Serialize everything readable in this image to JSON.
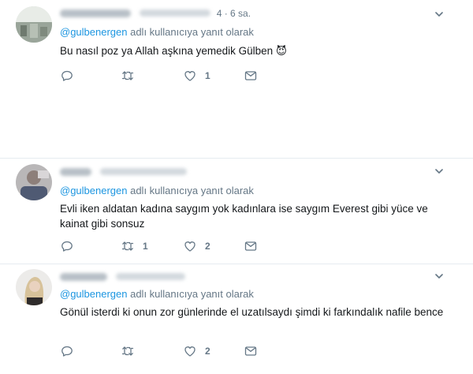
{
  "tweets": [
    {
      "author_name": "",
      "author_handle": "",
      "time": "4 · 6 sa.",
      "reply_prefix": "@gulbenergen",
      "reply_suffix": " adlı kullanıcıya yanıt olarak",
      "text": "Bu nasıl poz ya Allah aşkına yemedik Gülben 😈",
      "replies": "",
      "retweets": "",
      "likes": "1",
      "icons": [
        "reply-icon",
        "retweet-icon",
        "like-icon",
        "message-icon"
      ]
    },
    {
      "author_name": "",
      "author_handle": "",
      "time": "",
      "reply_prefix": "@gulbenergen",
      "reply_suffix": " adlı kullanıcıya yanıt olarak",
      "text": "Evli iken aldatan kadına saygım yok kadınlara ise saygım Everest gibi yüce ve kainat gibi sonsuz",
      "replies": "",
      "retweets": "1",
      "likes": "2",
      "icons": [
        "reply-icon",
        "retweet-icon",
        "like-icon",
        "message-icon"
      ]
    },
    {
      "author_name": "",
      "author_handle": "",
      "time": "",
      "reply_prefix": "@gulbenergen",
      "reply_suffix": " adlı kullanıcıya yanıt olarak",
      "text": "Gönül isterdi ki onun zor günlerinde el uzatılsaydı şimdi ki farkındalık nafile bence",
      "replies": "",
      "retweets": "",
      "likes": "2",
      "icons": [
        "reply-icon",
        "retweet-icon",
        "like-icon",
        "message-icon"
      ]
    }
  ],
  "colors": {
    "mention": "#1b95e0",
    "secondary_text": "#657786",
    "divider": "#e6ecf0"
  }
}
